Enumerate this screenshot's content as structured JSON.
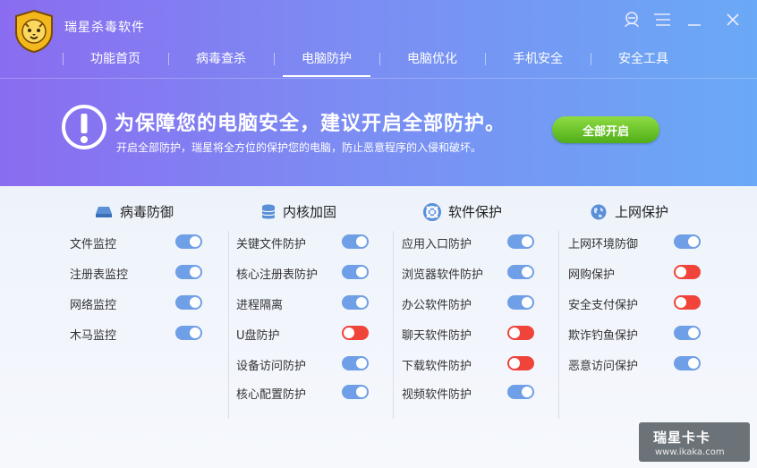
{
  "app": {
    "title": "瑞星杀毒软件"
  },
  "nav": [
    {
      "label": "功能首页",
      "active": false
    },
    {
      "label": "病毒查杀",
      "active": false
    },
    {
      "label": "电脑防护",
      "active": true
    },
    {
      "label": "电脑优化",
      "active": false
    },
    {
      "label": "手机安全",
      "active": false
    },
    {
      "label": "安全工具",
      "active": false
    }
  ],
  "banner": {
    "headline": "为保障您的电脑安全，建议开启全部防护。",
    "subline": "开启全部防护，瑞星将全方位的保护您的电脑，防止恶意程序的入侵和破坏。",
    "button": "全部开启"
  },
  "columns": [
    {
      "title": "病毒防御",
      "icon": "disk-icon",
      "items": [
        {
          "label": "文件监控",
          "on": true
        },
        {
          "label": "注册表监控",
          "on": true
        },
        {
          "label": "网络监控",
          "on": true
        },
        {
          "label": "木马监控",
          "on": true
        }
      ]
    },
    {
      "title": "内核加固",
      "icon": "database-icon",
      "items": [
        {
          "label": "关键文件防护",
          "on": true
        },
        {
          "label": "核心注册表防护",
          "on": true
        },
        {
          "label": "进程隔离",
          "on": true
        },
        {
          "label": "U盘防护",
          "on": false
        },
        {
          "label": "设备访问防护",
          "on": true
        },
        {
          "label": "核心配置防护",
          "on": true
        }
      ]
    },
    {
      "title": "软件保护",
      "icon": "lifebuoy-icon",
      "items": [
        {
          "label": "应用入口防护",
          "on": true
        },
        {
          "label": "浏览器软件防护",
          "on": true
        },
        {
          "label": "办公软件防护",
          "on": true
        },
        {
          "label": "聊天软件防护",
          "on": false
        },
        {
          "label": "下载软件防护",
          "on": false
        },
        {
          "label": "视频软件防护",
          "on": true
        }
      ]
    },
    {
      "title": "上网保护",
      "icon": "globe-icon",
      "items": [
        {
          "label": "上网环境防御",
          "on": true
        },
        {
          "label": "网购保护",
          "on": false
        },
        {
          "label": "安全支付保护",
          "on": false
        },
        {
          "label": "欺诈钓鱼保护",
          "on": true
        },
        {
          "label": "恶意访问保护",
          "on": true
        }
      ]
    }
  ],
  "watermark": {
    "big": "瑞星卡卡",
    "small": "www.ikaka.com"
  },
  "colors": {
    "toggle_on": "#6f9fe6",
    "toggle_off": "#f0443a",
    "button_green": "#5fbf22"
  }
}
